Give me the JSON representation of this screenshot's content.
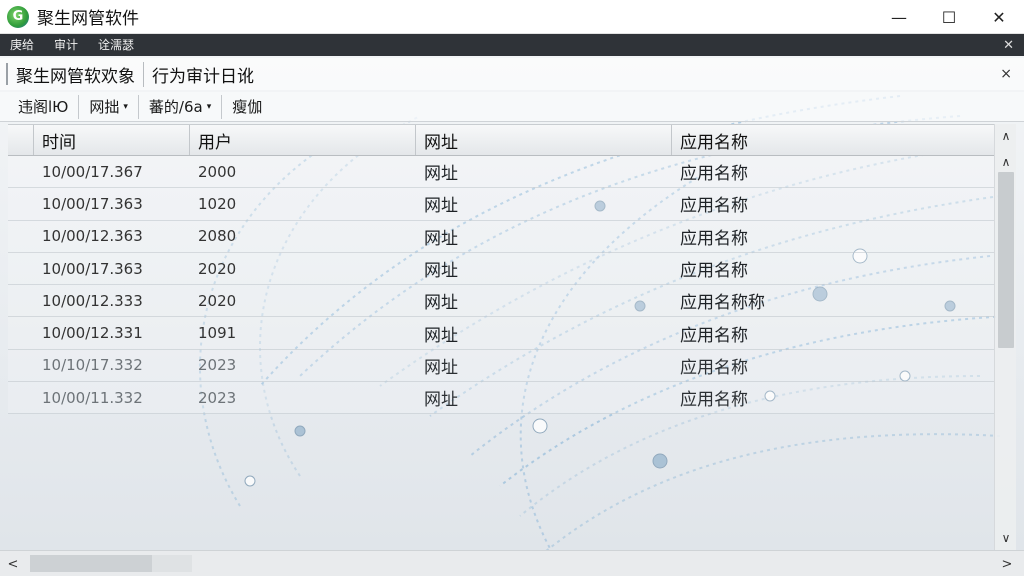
{
  "window": {
    "title": "聚生网管软件",
    "app_icon_glyph": "G",
    "controls": {
      "minimize": "—",
      "maximize": "☐",
      "close": "✕"
    }
  },
  "menubar": {
    "items": [
      "庚给",
      "审计",
      "诠濡瑟"
    ],
    "close_glyph": "✕"
  },
  "tabs": {
    "items": [
      "聚生网管软欢象",
      "行为审计日讹"
    ],
    "close_glyph": "×"
  },
  "toolbar": {
    "buttons": [
      {
        "label": "违阁lЮ",
        "has_dropdown": false
      },
      {
        "label": "网拙",
        "has_dropdown": true
      },
      {
        "label": "蕃的/6a",
        "has_dropdown": true
      },
      {
        "label": "瘦伽",
        "has_dropdown": false
      }
    ],
    "caret_glyph": "▾"
  },
  "table": {
    "columns": [
      "时间",
      "用户",
      "网址",
      "应用名称"
    ],
    "rows": [
      {
        "time": "10/00/17.367",
        "user": "2000",
        "url": "网址",
        "app": "应用名称"
      },
      {
        "time": "10/00/17.363",
        "user": "1020",
        "url": "网址",
        "app": "应用名称"
      },
      {
        "time": "10/00/12.363",
        "user": "2080",
        "url": "网址",
        "app": "应用名称"
      },
      {
        "time": "10/00/17.363",
        "user": "2020",
        "url": "网址",
        "app": "应用名称"
      },
      {
        "time": "10/00/12.333",
        "user": "2020",
        "url": "网址",
        "app": "应用名称称"
      },
      {
        "time": "10/00/12.331",
        "user": "1091",
        "url": "网址",
        "app": "应用名称"
      },
      {
        "time": "10/10/17.332",
        "user": "2023",
        "url": "网址",
        "app": "应用名称"
      },
      {
        "time": "10/00/11.332",
        "user": "2023",
        "url": "网址",
        "app": "应用名称"
      }
    ]
  },
  "scrollbars": {
    "up_glyph": "∧",
    "down_glyph": "∨",
    "left_glyph": "<",
    "right_glyph": ">"
  },
  "colors": {
    "menubar_bg": "#2f3338",
    "accent_line": "#8fb8d8"
  }
}
